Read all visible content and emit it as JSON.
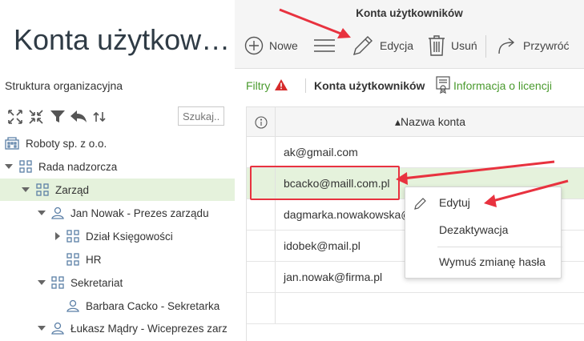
{
  "left": {
    "page_title": "Konta użytkow…",
    "section_title": "Struktura organizacyjna",
    "toolbar_icons": [
      "expand-icon",
      "collapse-icon",
      "filter-icon",
      "undo-icon",
      "refresh-icon"
    ],
    "search_placeholder": "Szukaj...",
    "tree": [
      {
        "label": "Roboty sp. z o.o.",
        "icon": "building-icon",
        "level": 0,
        "caret": "none"
      },
      {
        "label": "Rada nadzorcza",
        "icon": "org-unit-icon",
        "level": 0,
        "caret": "down"
      },
      {
        "label": "Zarząd",
        "icon": "org-unit-icon",
        "level": 1,
        "caret": "down",
        "selected": true
      },
      {
        "label": "Jan Nowak - Prezes zarządu",
        "icon": "person-icon",
        "level": 2,
        "caret": "down"
      },
      {
        "label": "Dział Księgowości",
        "icon": "org-unit-icon",
        "level": 3,
        "caret": "right"
      },
      {
        "label": "HR",
        "icon": "org-unit-icon",
        "level": 3,
        "caret": "none"
      },
      {
        "label": "Sekretariat",
        "icon": "org-unit-icon",
        "level": 2,
        "caret": "down"
      },
      {
        "label": "Barbara Cacko - Sekretarka",
        "icon": "person-icon",
        "level": 3,
        "caret": "none"
      },
      {
        "label": "Łukasz Mądry - Wiceprezes zarz",
        "icon": "person-icon",
        "level": 2,
        "caret": "down"
      }
    ]
  },
  "right": {
    "window_title": "Konta użytkowników",
    "toolbar": {
      "new_label": "Nowe",
      "edit_label": "Edycja",
      "delete_label": "Usuń",
      "restore_label": "Przywróć"
    },
    "filters_label": "Filtry",
    "accounts_label": "Konta użytkowników",
    "license_label": "Informacja o licencji",
    "column_header": "▴Nazwa konta",
    "rows": [
      "ak@gmail.com",
      "bcacko@maill.com.pl",
      "dagmarka.nowakowska@",
      "idobek@mail.pl",
      "jan.nowak@firma.pl"
    ],
    "selected_row": 1
  },
  "context_menu": {
    "items": [
      "Edytuj",
      "Dezaktywacja",
      "Wymuś zmianę hasła"
    ]
  },
  "colors": {
    "accent_green": "#4a9a2e",
    "selection_bg": "#e5f2dc",
    "annotation_red": "#e8323f"
  }
}
